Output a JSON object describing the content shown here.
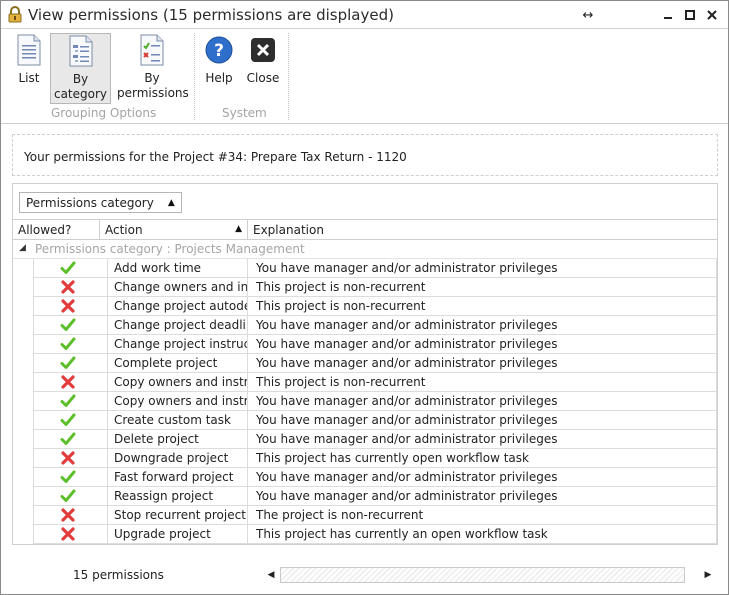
{
  "window": {
    "title": "View permissions (15 permissions are displayed)",
    "buttons": {
      "restore_icon": "resize-arrows-icon",
      "minimize": "minimize-icon",
      "maximize": "maximize-icon",
      "close": "close-icon"
    }
  },
  "ribbon": {
    "buttons": [
      {
        "label": "List",
        "icon": "list-document-icon"
      },
      {
        "label": "By category",
        "icon": "category-document-icon",
        "active": true
      },
      {
        "label": "By permissions",
        "icon": "permissions-document-icon"
      },
      {
        "label": "Help",
        "icon": "help-icon"
      },
      {
        "label": "Close",
        "icon": "close-icon"
      }
    ],
    "groups": [
      {
        "label": "Grouping Options"
      },
      {
        "label": "System"
      }
    ]
  },
  "project": {
    "text": "Your permissions for the Project #34: Prepare Tax Return - 1120"
  },
  "grid": {
    "group_chip": "Permissions category",
    "columns": {
      "allowed": "Allowed?",
      "action": "Action",
      "explanation": "Explanation"
    },
    "group_row": "Permissions category : Projects Management",
    "rows": [
      {
        "allowed": true,
        "action": "Add work time",
        "explanation": "You have manager and/or administrator privileges"
      },
      {
        "allowed": false,
        "action": "Change owners and instr",
        "explanation": "This project is non-recurrent"
      },
      {
        "allowed": false,
        "action": "Change project autodea",
        "explanation": "This project is non-recurrent"
      },
      {
        "allowed": true,
        "action": "Change project deadline",
        "explanation": "You have manager and/or administrator privileges"
      },
      {
        "allowed": true,
        "action": "Change project instructio",
        "explanation": "You have manager and/or administrator privileges"
      },
      {
        "allowed": true,
        "action": "Complete project",
        "explanation": "You have manager and/or administrator privileges"
      },
      {
        "allowed": false,
        "action": "Copy owners and instruc",
        "explanation": "This project is non-recurrent"
      },
      {
        "allowed": true,
        "action": "Copy owners and instruc",
        "explanation": "You have manager and/or administrator privileges"
      },
      {
        "allowed": true,
        "action": "Create custom task",
        "explanation": "You have manager and/or administrator privileges"
      },
      {
        "allowed": true,
        "action": "Delete project",
        "explanation": "You have manager and/or administrator privileges"
      },
      {
        "allowed": false,
        "action": "Downgrade project",
        "explanation": "This project has currently open workflow task"
      },
      {
        "allowed": true,
        "action": "Fast forward project",
        "explanation": "You have manager and/or administrator privileges"
      },
      {
        "allowed": true,
        "action": "Reassign project",
        "explanation": "You have manager and/or administrator privileges"
      },
      {
        "allowed": false,
        "action": "Stop recurrent project",
        "explanation": "The project is non-recurrent"
      },
      {
        "allowed": false,
        "action": "Upgrade project",
        "explanation": "This project has currently an open workflow task"
      }
    ],
    "footer_count": "15 permissions"
  },
  "colors": {
    "check": "#5cbf2a",
    "cross": "#e03c3c",
    "help_blue": "#2d6fcb",
    "group_text": "#a5a5a5"
  }
}
